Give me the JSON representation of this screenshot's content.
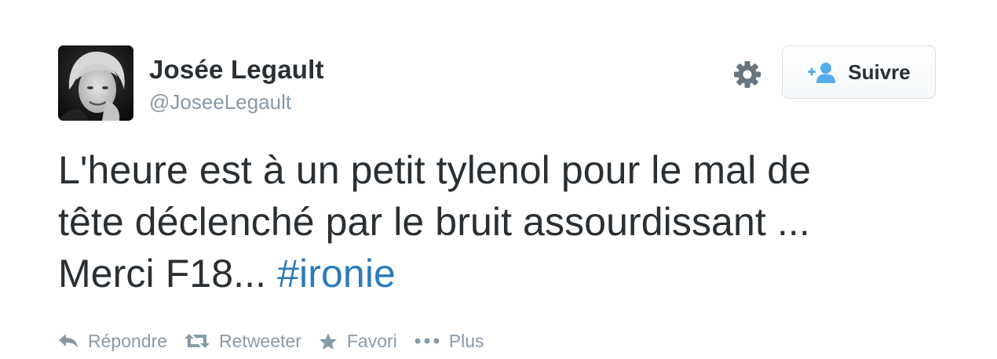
{
  "author": {
    "name": "Josée Legault",
    "handle": "@JoseeLegault"
  },
  "header": {
    "settings_icon": "gear-icon",
    "follow_icon": "add-user-icon",
    "follow_label": "Suivre"
  },
  "tweet": {
    "text_line1": "L'heure est à un petit tylenol pour le mal de",
    "text_line2": "tête déclenché par le bruit assourdissant ...",
    "text_line3_prefix": "Merci F18... ",
    "hashtag": "#ironie"
  },
  "actions": {
    "reply_label": "Répondre",
    "retweet_label": "Retweeter",
    "favorite_label": "Favori",
    "more_label": "Plus"
  },
  "colors": {
    "text": "#292f33",
    "muted": "#8899a6",
    "link": "#2b7bb9",
    "follow_icon": "#55acee"
  }
}
